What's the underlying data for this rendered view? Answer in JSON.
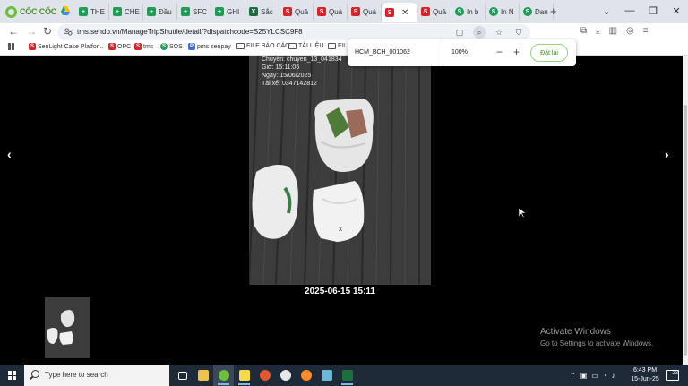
{
  "browser": {
    "brand_name": "CỐC CỐC",
    "tabs": [
      {
        "label": "THE",
        "icon": "sheet"
      },
      {
        "label": "CHE",
        "icon": "sheet"
      },
      {
        "label": "Đầu",
        "icon": "sheet"
      },
      {
        "label": "SFC",
        "icon": "sheet"
      },
      {
        "label": "GHI",
        "icon": "sheet"
      },
      {
        "label": "Sắc",
        "icon": "excel"
      },
      {
        "label": "Quả",
        "icon": "sendo"
      },
      {
        "label": "Quả",
        "icon": "sendo"
      },
      {
        "label": "Quả",
        "icon": "sendo"
      },
      {
        "label": "",
        "icon": "sendo",
        "active": true
      },
      {
        "label": "Quả",
        "icon": "sendo"
      },
      {
        "label": "In b",
        "icon": "round"
      },
      {
        "label": "In N",
        "icon": "round"
      },
      {
        "label": "Dan",
        "icon": "round"
      }
    ],
    "new_tab": "+",
    "window_controls": [
      "⌄",
      "—",
      "❐",
      "✕"
    ],
    "url": "tms.sendo.vn/ManageTripShuttle/detail/?dispatchcode=S25YLCSC9F8",
    "bookmarks": [
      {
        "label": "SenLight Case Platfor...",
        "icon": "sendo"
      },
      {
        "label": "OPC",
        "icon": "sendo"
      },
      {
        "label": "tms",
        "icon": "sendo"
      },
      {
        "label": "SOS",
        "icon": "round"
      },
      {
        "label": "pms senpay",
        "icon": "p"
      },
      {
        "label": "FILE BÁO CÁO",
        "icon": "folder"
      },
      {
        "label": "TÀI LIỆU",
        "icon": "folder"
      },
      {
        "label": "FIL",
        "icon": "folder"
      }
    ]
  },
  "zoom_popup": {
    "site_label": "HCM_BCH_001062",
    "zoom_level": "100%",
    "minus": "−",
    "plus": "+",
    "reset_label": "Đặt lại"
  },
  "viewer": {
    "prev_arrow": "‹",
    "next_arrow": "›",
    "watermark_lines": [
      "Chuyến: chuyen_13_041834",
      "Giờ: 15:11:06",
      "Ngày: 15/06/2025",
      "Tài xế: 0347142812"
    ],
    "caption": "2025-06-15 15:11"
  },
  "activation": {
    "title": "Activate Windows",
    "subtitle": "Go to Settings to activate Windows."
  },
  "taskbar": {
    "search_placeholder": "Type here to search",
    "time": "6:43 PM",
    "date": "15-Jun-25",
    "notification_count": "23"
  }
}
